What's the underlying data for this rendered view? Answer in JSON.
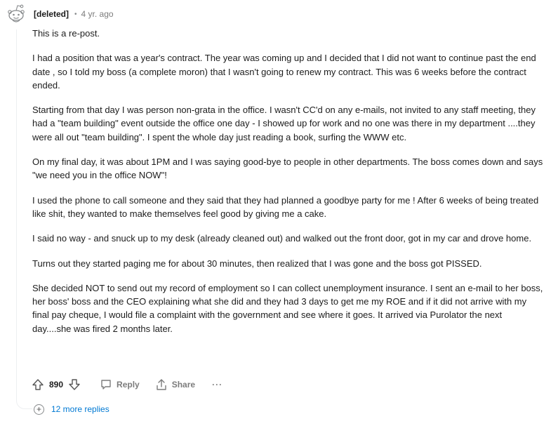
{
  "comment": {
    "author": "[deleted]",
    "separator": "•",
    "timestamp": "4 yr. ago",
    "paragraphs": [
      "This is a re-post.",
      "I had a position that was a year's contract. The year was coming up and I decided that I did not want to continue past the end date , so I told my boss (a complete moron) that I wasn't going to renew my contract. This was 6 weeks before the contract ended.",
      "Starting from that day I was person non-grata in the office. I wasn't CC'd on any e-mails, not invited to any staff meeting, they had a \"team building\" event outside the office one day - I showed up for work and no one was there in my department ....they were all out \"team building\". I spent the whole day just reading a book, surfing the WWW etc.",
      "On my final day, it was about 1PM and I was saying good-bye to people in other departments. The boss comes down and says \"we need you in the office NOW\"!",
      "I used the phone to call someone and they said that they had planned a goodbye party for me ! After 6 weeks of being treated like shit, they wanted to make themselves feel good by giving me a cake.",
      "I said no way - and snuck up to my desk (already cleaned out) and walked out the front door, got in my car and drove home.",
      "Turns out they started paging me for about 30 minutes, then realized that I was gone and the boss got PISSED.",
      "She decided NOT to send out my record of employment so I can collect unemployment insurance. I sent an e-mail to her boss, her boss' boss and the CEO explaining what she did and they had 3 days to get me my ROE and if it did not arrive with my final pay cheque, I would file a complaint with the government and see where it goes. It arrived via Purolator the next day....she was fired 2 months later."
    ]
  },
  "actions": {
    "vote_count": "890",
    "reply_label": "Reply",
    "share_label": "Share",
    "more_label": "···",
    "upvote_icon": "arrow-up-icon",
    "downvote_icon": "arrow-down-icon",
    "reply_icon": "speech-bubble-icon",
    "share_icon": "share-icon"
  },
  "more_replies": {
    "icon": "+",
    "label": "12 more replies"
  },
  "colors": {
    "link": "#0079d3",
    "thread_line": "#edeff1",
    "muted": "#7c7c7c"
  }
}
